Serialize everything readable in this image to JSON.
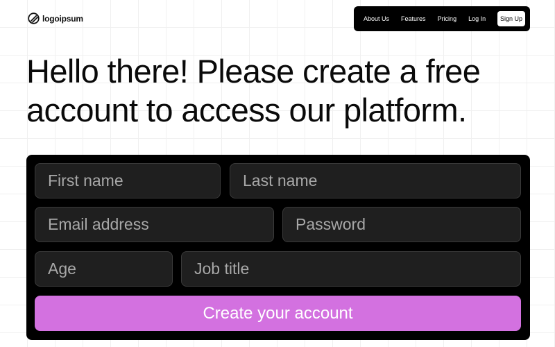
{
  "brand": {
    "name": "logoipsum",
    "icon": "logo-mark-icon"
  },
  "nav": {
    "links": [
      "About Us",
      "Features",
      "Pricing",
      "Log In"
    ],
    "signup_label": "Sign Up"
  },
  "hero": {
    "line1": "Hello there! Please create a free",
    "line2": "account to access our platform."
  },
  "form": {
    "first_name_placeholder": "First name",
    "last_name_placeholder": "Last name",
    "email_placeholder": "Email address",
    "password_placeholder": "Password",
    "age_placeholder": "Age",
    "job_title_placeholder": "Job title",
    "submit_label": "Create your account"
  },
  "colors": {
    "accent": "#d371e0",
    "panel": "#000000",
    "field": "#1f1f1f"
  }
}
